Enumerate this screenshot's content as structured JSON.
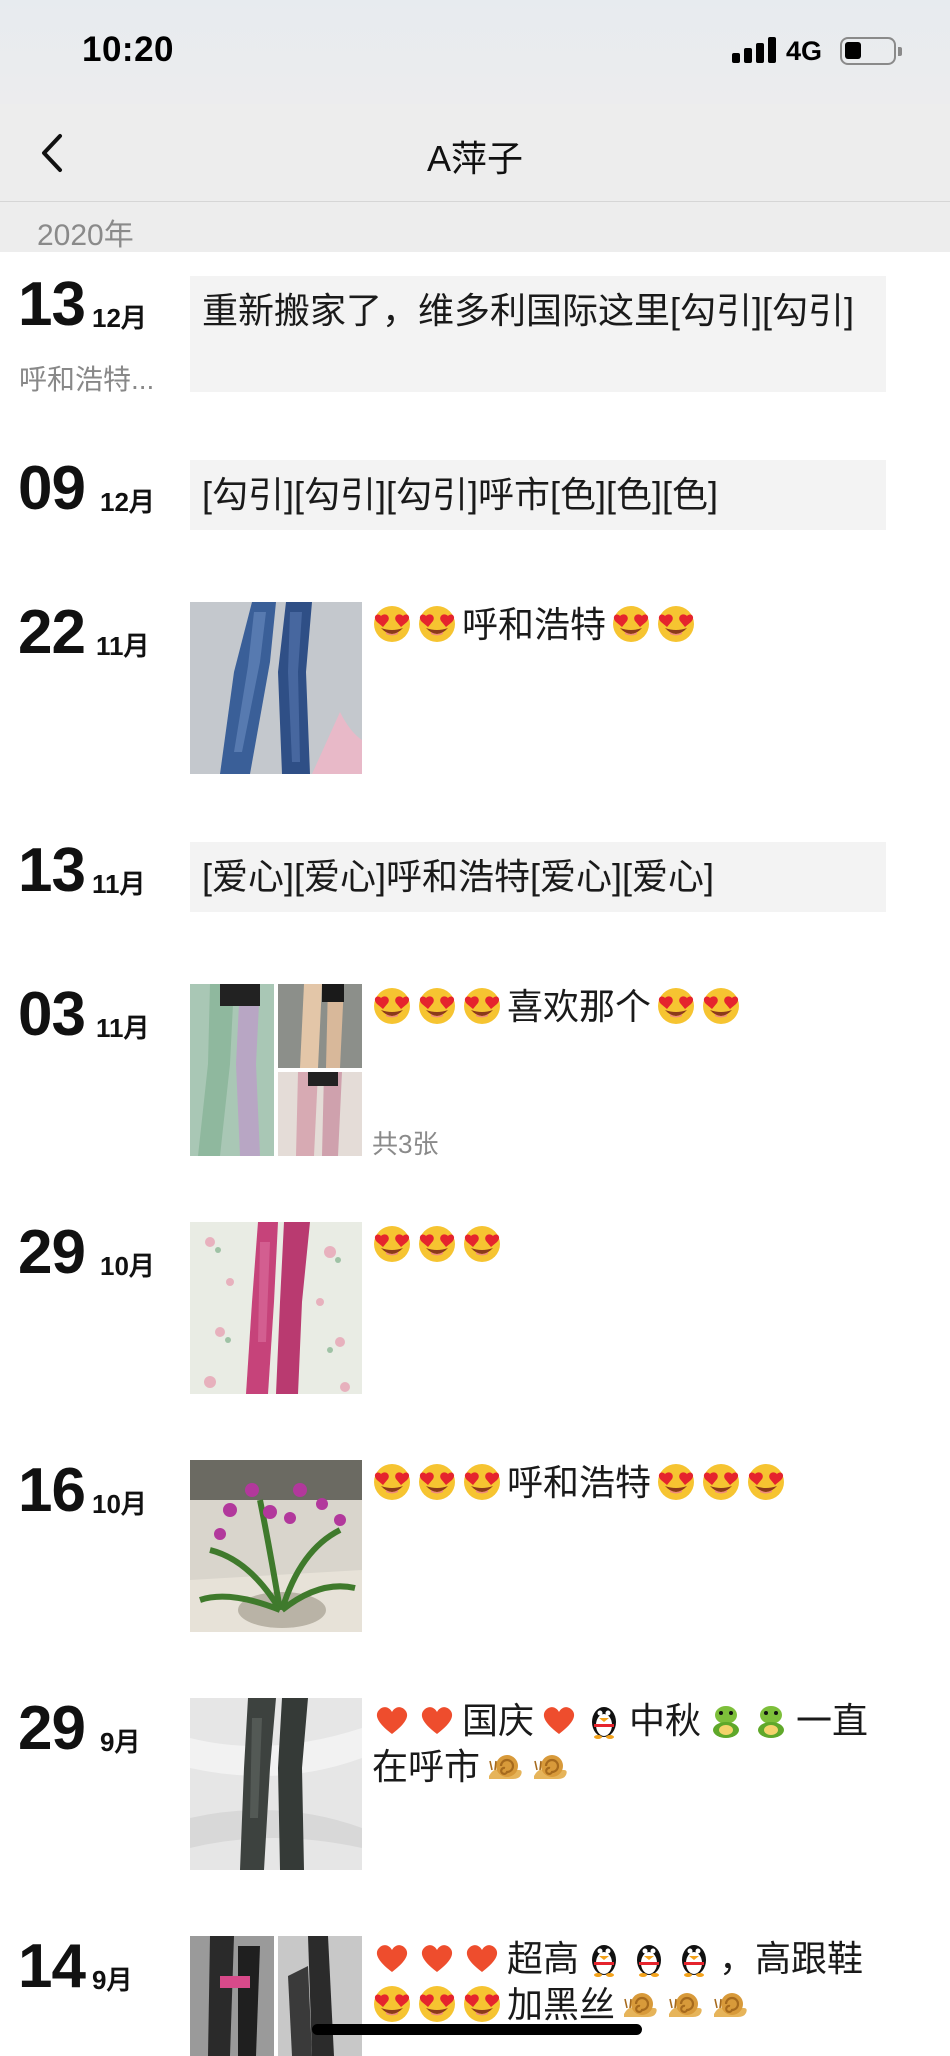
{
  "status": {
    "time": "10:20",
    "network": "4G"
  },
  "nav": {
    "title": "A萍子"
  },
  "timeline": {
    "year": "2020年"
  },
  "posts": [
    {
      "day": "13",
      "month": "12月",
      "location": "呼和浩特...",
      "text": "重新搬家了，维多利国际这里[勾引][勾引]"
    },
    {
      "day": "09",
      "month": "12月",
      "text": "[勾引][勾引][勾引]呼市[色][色][色]"
    },
    {
      "day": "22",
      "month": "11月",
      "caption": "呼和浩特",
      "photo": "blue-tights-photo"
    },
    {
      "day": "13",
      "month": "11月",
      "text": "[爱心][爱心]呼和浩特[爱心][爱心]"
    },
    {
      "day": "03",
      "month": "11月",
      "caption": "喜欢那个",
      "photo_count": "共3张"
    },
    {
      "day": "29",
      "month": "10月",
      "photo": "pink-tights-photo"
    },
    {
      "day": "16",
      "month": "10月",
      "caption": "呼和浩特",
      "photo": "orchid-plant-photo"
    },
    {
      "day": "29",
      "month": "9月",
      "caption_parts": [
        "国庆",
        "中秋",
        "一直",
        "在呼市"
      ],
      "photo": "black-tights-photo"
    },
    {
      "day": "14",
      "month": "9月",
      "caption_parts": [
        "超高",
        "，高跟鞋",
        "加黑丝"
      ]
    }
  ],
  "icons": [
    "back-chevron-icon",
    "signal-icon",
    "battery-icon",
    "heart-eyes-emoji",
    "heart-emoji",
    "penguin-emoji",
    "frog-emoji",
    "snail-emoji"
  ],
  "colors": {
    "bubble": "#f3f3f3",
    "nav": "#ededed",
    "meta": "#8a8a8a"
  }
}
